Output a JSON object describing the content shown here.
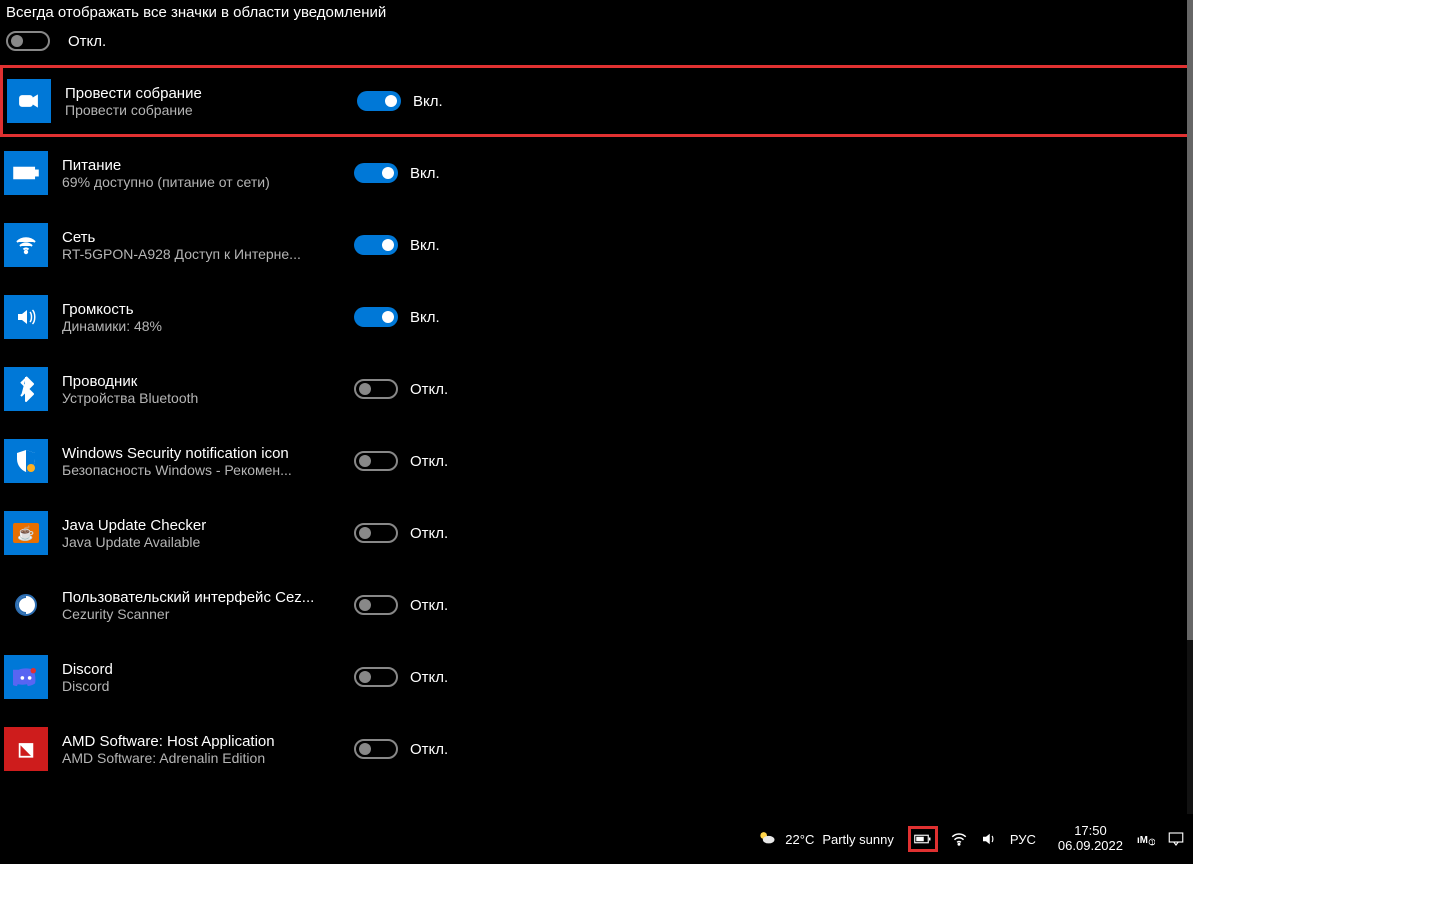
{
  "header": {
    "always_show": "Всегда отображать все значки в области уведомлений",
    "master_state_label": "Откл."
  },
  "labels": {
    "on": "Вкл.",
    "off": "Откл."
  },
  "items": [
    {
      "title": "Провести собрание",
      "subtitle": "Провести собрание",
      "on": true,
      "highlighted": true,
      "icon": "meet-now-icon"
    },
    {
      "title": "Питание",
      "subtitle": "69% доступно (питание от сети)",
      "on": true,
      "icon": "battery-icon"
    },
    {
      "title": "Сеть",
      "subtitle": "RT-5GPON-A928 Доступ к Интерне...",
      "on": true,
      "icon": "wifi-icon"
    },
    {
      "title": "Громкость",
      "subtitle": "Динамики: 48%",
      "on": true,
      "icon": "volume-icon"
    },
    {
      "title": "Проводник",
      "subtitle": "Устройства Bluetooth",
      "on": false,
      "icon": "bluetooth-icon"
    },
    {
      "title": "Windows Security notification icon",
      "subtitle": "Безопасность Windows - Рекомен...",
      "on": false,
      "icon": "security-icon"
    },
    {
      "title": "Java Update Checker",
      "subtitle": "Java Update Available",
      "on": false,
      "icon": "java-icon"
    },
    {
      "title": "Пользовательский интерфейс Cez...",
      "subtitle": "Cezurity Scanner",
      "on": false,
      "icon": "cezurity-icon",
      "outlined": true
    },
    {
      "title": "Discord",
      "subtitle": "Discord",
      "on": false,
      "icon": "discord-icon"
    },
    {
      "title": "AMD Software: Host Application",
      "subtitle": "AMD Software: Adrenalin Edition",
      "on": false,
      "icon": "amd-icon",
      "bg": "#ce1c1c"
    }
  ],
  "taskbar": {
    "weather_temp": "22°C",
    "weather_desc": "Partly sunny",
    "input_lang": "РУС",
    "time": "17:50",
    "date": "06.09.2022"
  }
}
